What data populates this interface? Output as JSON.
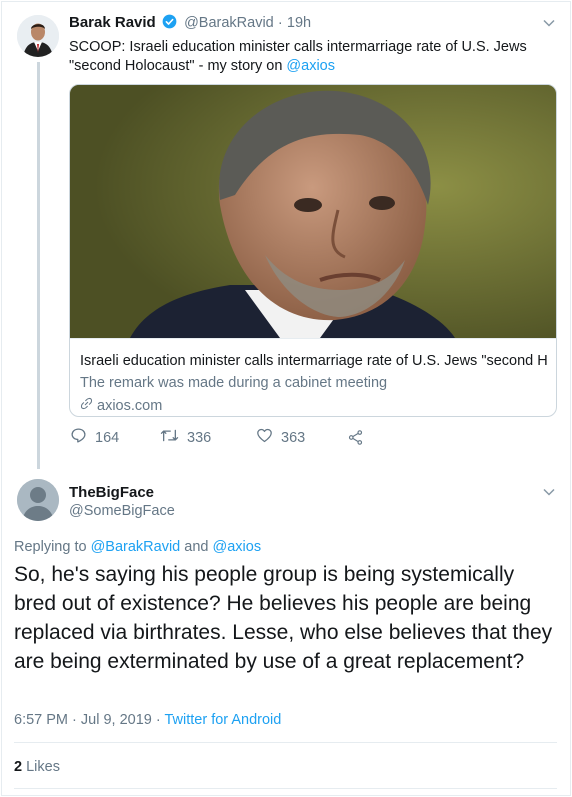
{
  "parent_tweet": {
    "author_name": "Barak Ravid",
    "handle": "@BarakRavid",
    "dot": "·",
    "time": "19h",
    "text_prefix": "SCOOP: Israeli education minister calls intermarriage rate of U.S. Jews \"second Holocaust\" - my story on ",
    "text_link": "@axios",
    "card": {
      "title": "Israeli education minister calls intermarriage rate of U.S. Jews \"second H...",
      "description": "The remark was made during a cabinet meeting",
      "domain": "axios.com"
    },
    "actions": {
      "replies": "164",
      "retweets": "336",
      "likes": "363"
    }
  },
  "reply_tweet": {
    "author_name": "TheBigFace",
    "handle": "@SomeBigFace",
    "replying_prefix": "Replying to ",
    "replying_user1": "@BarakRavid",
    "replying_and": " and ",
    "replying_user2": "@axios",
    "text": "So, he's saying his people group is being systemically bred out of existence? He believes his people are being replaced via birthrates. Lesse, who else believes that they are being exterminated by use of a great replacement?",
    "time": "6:57 PM",
    "sep": " · ",
    "date": "Jul 9, 2019",
    "source": "Twitter for Android",
    "likes_count": "2",
    "likes_label": "Likes"
  },
  "colors": {
    "accent": "#1da1f2",
    "secondary_text": "#657786",
    "border": "#e6ecf0"
  },
  "icons": [
    "verified-badge-icon",
    "chevron-down-icon",
    "reply-icon",
    "retweet-icon",
    "like-icon",
    "share-icon",
    "link-icon"
  ]
}
